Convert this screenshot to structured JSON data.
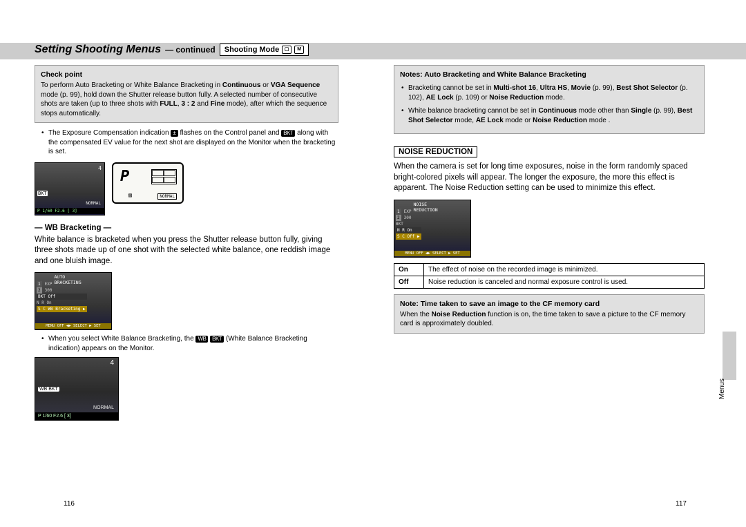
{
  "header": {
    "title": "Setting Shooting Menus",
    "sub": "— continued",
    "mode_label": "Shooting Mode"
  },
  "left": {
    "checkpoint": {
      "title": "Check point",
      "body_1": "To perform Auto Bracketing or White Balance Bracketing in ",
      "bold_1": "Continuous",
      "mid_1": " or ",
      "bold_2": "VGA Sequence",
      "body_2": " mode (p. 99), hold down the Shutter release button fully. A selected number of consecutive shots are taken (up to three shots with ",
      "bold_3": "FULL",
      "mid_2": ", ",
      "bold_4": "3 : 2",
      "mid_3": " and ",
      "bold_5": "Fine",
      "body_3": " mode), after which the sequence stops automatically."
    },
    "note1_a": "The Exposure Compensation indication ",
    "note1_b": " flashes on the Control panel and ",
    "note1_c": " along with the compensated EV value for the next shot are displayed on the Monitor when the bracketing is set.",
    "lcd_bkt": "BKT",
    "lcd_normal": "NORMAL",
    "lcd_p": "P",
    "lcd_bottom": "P   1/60   F2.6            [  3]",
    "wb_title": "— WB Bracketing —",
    "wb_body": "White balance is bracketed when you press the Shutter release button fully, giving three shots made up of one shot with the selected white balance, one reddish image and one bluish image.",
    "menu_title": "AUTO BRACKETING",
    "menu_rows": [
      "EXP",
      "300",
      "BKT  Off",
      "N R  On",
      "S  C  WB Bracketing  ▶"
    ],
    "menu_bottom": "MENU OFF  ◀▶ SELECT  ▶ SET",
    "note2_a": "When you select White Balance Bracketing, the ",
    "note2_b": " (White Balance Bracketing indication) appears on the Monitor.",
    "wb_badge": "WB BKT",
    "mon_normal": "NORMAL",
    "mon_count": "4",
    "page_num": "116"
  },
  "right": {
    "notes": {
      "title": "Notes: Auto Bracketing and White Balance Bracketing",
      "b1_a": "Bracketing cannot be set in ",
      "b1_bold1": "Multi-shot 16",
      "b1_mid1": ", ",
      "b1_bold2": "Ultra HS",
      "b1_mid2": ", ",
      "b1_bold3": "Movie",
      "b1_b": " (p. 99), ",
      "b1_bold4": "Best Shot Selector",
      "b1_c": " (p. 102), ",
      "b1_bold5": "AE Lock",
      "b1_d": " (p. 109) or ",
      "b1_bold6": "Noise Reduction",
      "b1_e": " mode.",
      "b2_a": "White balance bracketing cannot be set in ",
      "b2_bold1": "Continuous",
      "b2_b": " mode other than ",
      "b2_bold2": "Single",
      "b2_c": " (p. 99), ",
      "b2_bold3": "Best Shot Selector",
      "b2_d": " mode, ",
      "b2_bold4": "AE Lock",
      "b2_e": " mode or ",
      "b2_bold5": "Noise Reduction",
      "b2_f": " mode ."
    },
    "nr_title": "NOISE REDUCTION",
    "nr_body": "When the camera is set for long time exposures, noise in the form randomly spaced bright-colored pixels will appear. The longer the exposure, the more this effect is apparent. The Noise Reduction setting can be used to minimize this effect.",
    "nr_menu_title": "NOISE REDUCTION",
    "nr_menu_rows": [
      "EXP",
      "300",
      "BKT",
      "N R  On",
      "S  C     Off   ▶"
    ],
    "nr_menu_bottom": "MENU OFF  ◀▶ SELECT  ▶ SET",
    "table": {
      "r1c1": "On",
      "r1c2": "The effect of noise on the recorded image is minimized.",
      "r2c1": "Off",
      "r2c2": "Noise reduction is canceled and normal exposure control is used."
    },
    "cf_note": {
      "title": "Note: Time taken to save an image to the CF memory card",
      "body_a": "When the ",
      "bold_1": "Noise Reduction",
      "body_b": " function is on, the time taken to save a picture to the CF memory card is approximately doubled."
    },
    "tab_label": "Menus",
    "page_num": "117"
  }
}
